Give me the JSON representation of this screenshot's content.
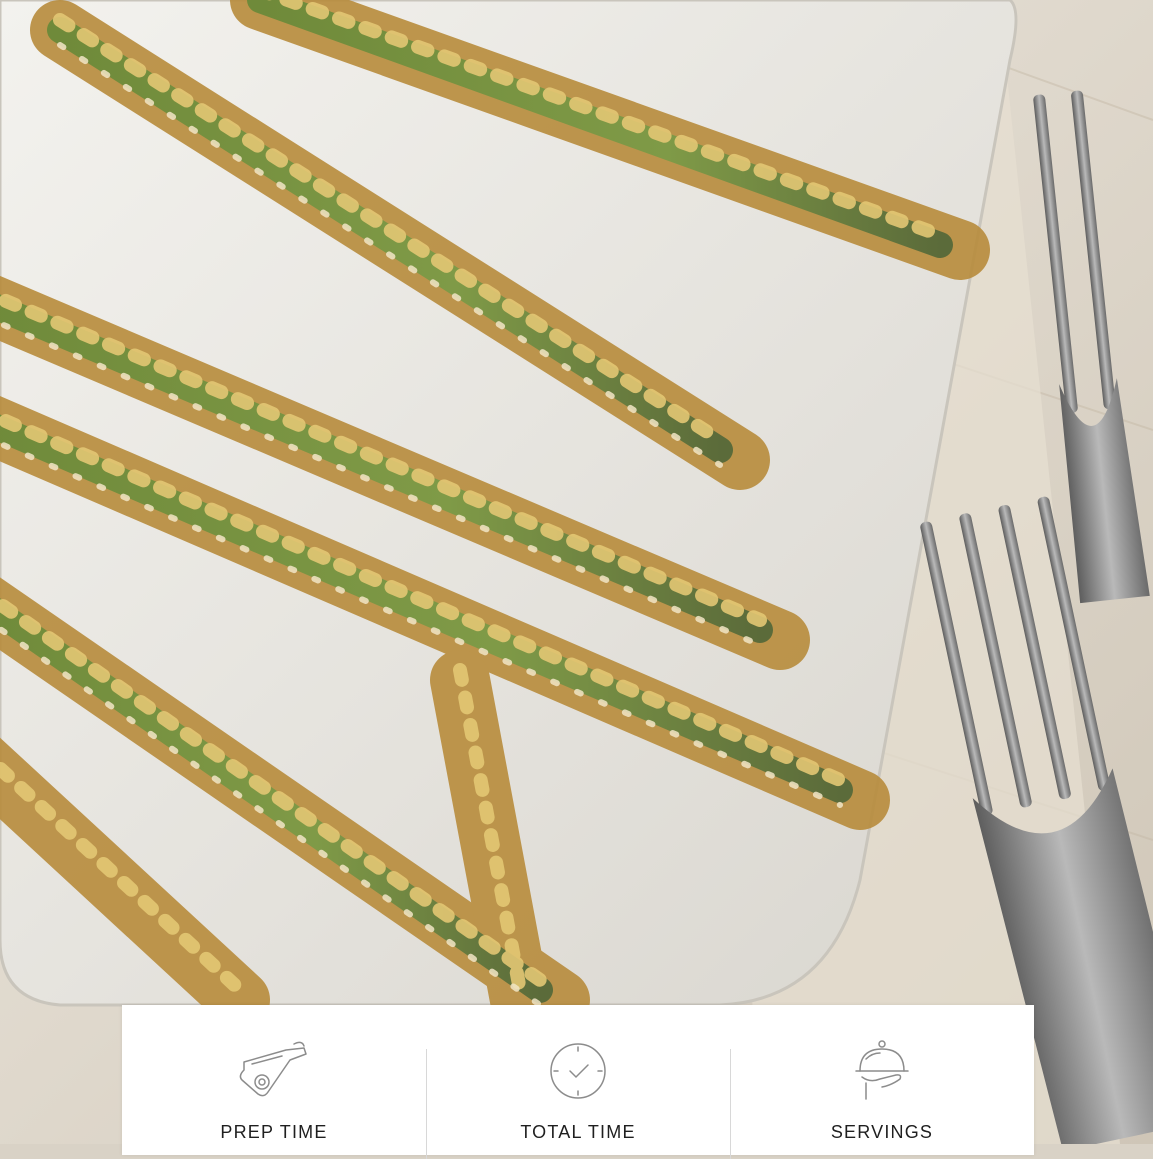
{
  "hero": {
    "icon": "food-photo",
    "description": ""
  },
  "recipe_info": [
    {
      "label": "PREP TIME",
      "icon": "cutting-board-icon"
    },
    {
      "label": "TOTAL TIME",
      "icon": "clock-icon"
    },
    {
      "label": "SERVINGS",
      "icon": "serving-cloche-icon"
    }
  ],
  "colors": {
    "card_bg": "#ffffff",
    "label": "#1f1f1f",
    "divider": "#d8d8d8",
    "icon": "#8c8c8c"
  }
}
